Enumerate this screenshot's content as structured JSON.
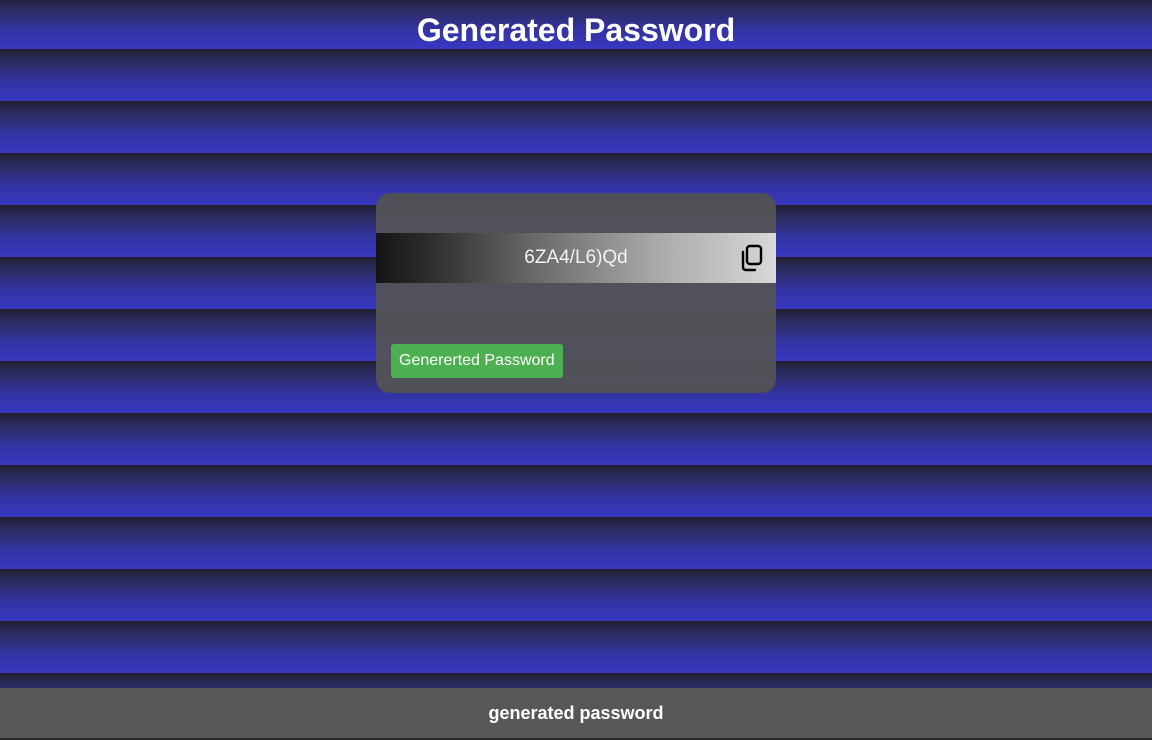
{
  "header": {
    "title": "Generated Password"
  },
  "card": {
    "password_value": "6ZA4/L6)Qd",
    "copy_icon": "copy-icon",
    "generate_button_label": "Genererted Password"
  },
  "footer": {
    "text": "generated password"
  },
  "colors": {
    "button_green": "#4caf50",
    "card_gray": "#555555",
    "footer_gray": "#575757",
    "stripe_blue": "#3838c4"
  }
}
